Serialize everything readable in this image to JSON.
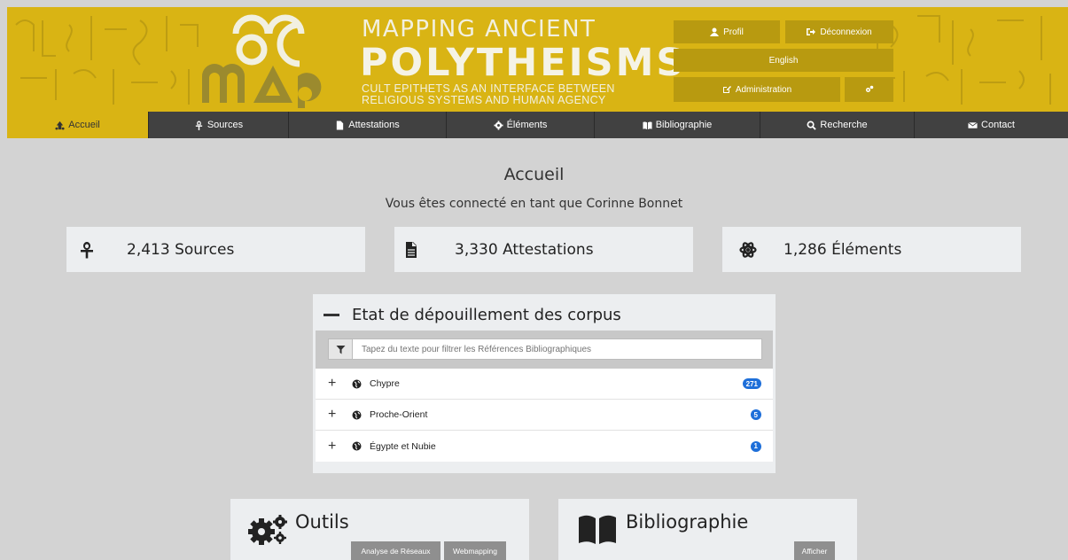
{
  "header": {
    "title_line1": "MAPPING ANCIENT",
    "title_line2": "POLYTHEISMS",
    "subtitle_line1": "CULT EPITHETS AS AN INTERFACE BETWEEN",
    "subtitle_line2": "RELIGIOUS SYSTEMS AND HUMAN AGENCY",
    "logo_text": "MAP",
    "profile_label": "Profil",
    "logout_label": "Déconnexion",
    "language_label": "English",
    "admin_label": "Administration",
    "brand_color": "#d9b414",
    "button_color": "#b89a10"
  },
  "nav": {
    "items": [
      {
        "label": "Accueil",
        "icon": "home-icon",
        "active": true
      },
      {
        "label": "Sources",
        "icon": "ankh-icon"
      },
      {
        "label": "Attestations",
        "icon": "file-icon"
      },
      {
        "label": "Éléments",
        "icon": "cog-icon"
      },
      {
        "label": "Bibliographie",
        "icon": "book-icon"
      },
      {
        "label": "Recherche",
        "icon": "search-icon"
      },
      {
        "label": "Contact",
        "icon": "envelope-icon"
      }
    ]
  },
  "main": {
    "title": "Accueil",
    "connected_text": "Vous êtes connecté en tant que Corinne Bonnet",
    "stats": [
      {
        "icon": "ankh-icon",
        "text": "2,413 Sources"
      },
      {
        "icon": "file-icon",
        "text": "3,330 Attestations"
      },
      {
        "icon": "atom-icon",
        "text": "1,286 Éléments"
      }
    ],
    "corpus_panel": {
      "title": "Etat de dépouillement des corpus",
      "filter_placeholder": "Tapez du texte pour filtrer les Références Bibliographiques",
      "rows": [
        {
          "label": "Chypre",
          "count": "271"
        },
        {
          "label": "Proche-Orient",
          "count": "5"
        },
        {
          "label": "Égypte et Nubie",
          "count": "1"
        }
      ]
    },
    "tools": {
      "title": "Outils",
      "network_button": "Analyse de Réseaux",
      "webmapping_button": "Webmapping"
    },
    "bibliography": {
      "title": "Bibliographie",
      "show_button": "Afficher"
    }
  }
}
